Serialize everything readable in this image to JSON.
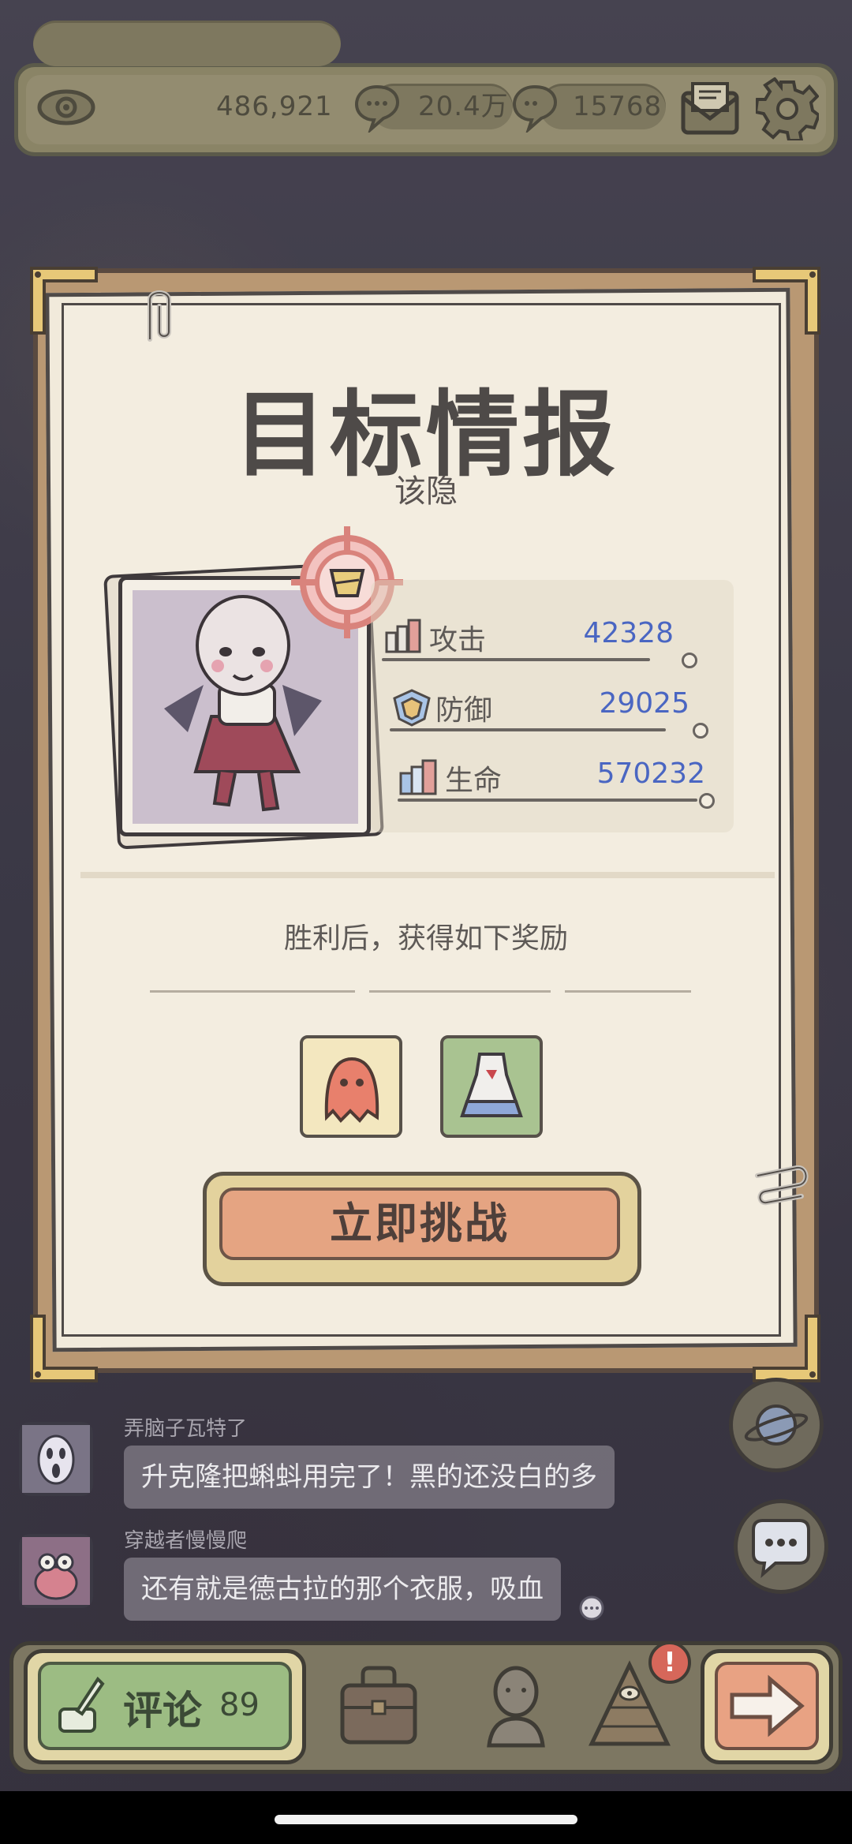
{
  "topbar": {
    "views": "486,921",
    "comments_a": "20.4万",
    "comments_b": "15768",
    "icons": [
      "eye-icon",
      "speech-bubble-icon",
      "speech-bubble-icon",
      "mail-icon",
      "gear-icon"
    ]
  },
  "card": {
    "title": "目标情报",
    "subtitle": "该隐",
    "stats": [
      {
        "label": "攻击",
        "value": "42328",
        "icon": "attack-icon"
      },
      {
        "label": "防御",
        "value": "29025",
        "icon": "defense-icon"
      },
      {
        "label": "生命",
        "value": "570232",
        "icon": "health-icon"
      }
    ],
    "reward_title": "胜利后，获得如下奖励",
    "rewards": [
      "ghost-costume-reward",
      "dress-reward"
    ],
    "challenge_label": "立即挑战"
  },
  "chat": [
    {
      "name": "弄脑子瓦特了",
      "message": "升克隆把蝌蚪用完了！黑的还没白的多"
    },
    {
      "name": "穿越者慢慢爬",
      "message": "还有就是德古拉的那个衣服，吸血"
    }
  ],
  "bottom": {
    "comment_label": "评论",
    "comment_count": "89",
    "alert_badge": "!"
  },
  "colors": {
    "stat_value": "#4a66c2",
    "challenge_button": "#e5a482",
    "comment_button": "#9cbc83",
    "paper": "#f3ede0"
  }
}
